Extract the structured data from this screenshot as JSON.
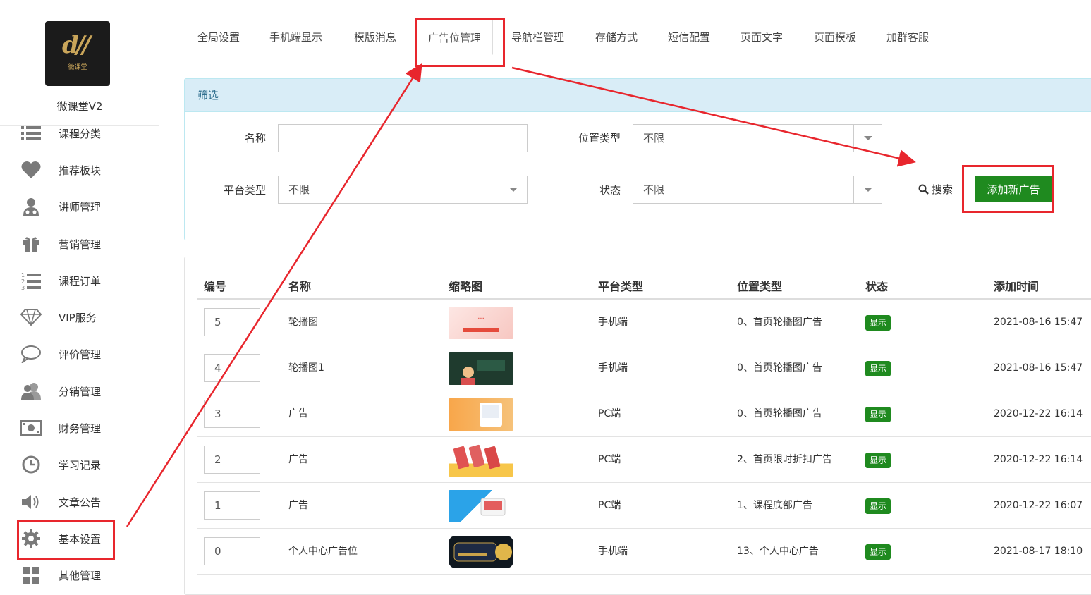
{
  "app": {
    "name": "微课堂V2",
    "logo_text": "微课堂"
  },
  "sidebar": {
    "items": [
      {
        "label": "课程分类",
        "icon": "list-icon"
      },
      {
        "label": "推荐板块",
        "icon": "heart-icon"
      },
      {
        "label": "讲师管理",
        "icon": "teacher-icon"
      },
      {
        "label": "营销管理",
        "icon": "gift-icon"
      },
      {
        "label": "课程订单",
        "icon": "ordered-list-icon"
      },
      {
        "label": "VIP服务",
        "icon": "diamond-icon"
      },
      {
        "label": "评价管理",
        "icon": "comment-icon"
      },
      {
        "label": "分销管理",
        "icon": "users-icon"
      },
      {
        "label": "财务管理",
        "icon": "money-icon"
      },
      {
        "label": "学习记录",
        "icon": "clock-icon"
      },
      {
        "label": "文章公告",
        "icon": "speaker-icon"
      },
      {
        "label": "基本设置",
        "icon": "gear-icon"
      },
      {
        "label": "其他管理",
        "icon": "grid-icon"
      }
    ]
  },
  "tabs": [
    {
      "label": "全局设置"
    },
    {
      "label": "手机端显示"
    },
    {
      "label": "模版消息"
    },
    {
      "label": "广告位管理"
    },
    {
      "label": "导航栏管理"
    },
    {
      "label": "存储方式"
    },
    {
      "label": "短信配置"
    },
    {
      "label": "页面文字"
    },
    {
      "label": "页面模板"
    },
    {
      "label": "加群客服"
    }
  ],
  "filter": {
    "title": "筛选",
    "name_label": "名称",
    "name_value": "",
    "position_label": "位置类型",
    "position_value": "不限",
    "platform_label": "平台类型",
    "platform_value": "不限",
    "status_label": "状态",
    "status_value": "不限",
    "search_label": "搜索",
    "add_label": "添加新广告"
  },
  "table": {
    "headers": [
      "编号",
      "名称",
      "缩略图",
      "平台类型",
      "位置类型",
      "状态",
      "添加时间"
    ],
    "rows": [
      {
        "num": "5",
        "name": "轮播图",
        "platform": "手机端",
        "position": "0、首页轮播图广告",
        "status": "显示",
        "time": "2021-08-16 15:47"
      },
      {
        "num": "4",
        "name": "轮播图1",
        "platform": "手机端",
        "position": "0、首页轮播图广告",
        "status": "显示",
        "time": "2021-08-16 15:47"
      },
      {
        "num": "3",
        "name": "广告",
        "platform": "PC端",
        "position": "0、首页轮播图广告",
        "status": "显示",
        "time": "2020-12-22 16:14"
      },
      {
        "num": "2",
        "name": "广告",
        "platform": "PC端",
        "position": "2、首页限时折扣广告",
        "status": "显示",
        "time": "2020-12-22 16:14"
      },
      {
        "num": "1",
        "name": "广告",
        "platform": "PC端",
        "position": "1、课程底部广告",
        "status": "显示",
        "time": "2020-12-22 16:07"
      },
      {
        "num": "0",
        "name": "个人中心广告位",
        "platform": "手机端",
        "position": "13、个人中心广告",
        "status": "显示",
        "time": "2021-08-17 18:10"
      }
    ]
  },
  "colors": {
    "highlight": "#e8262d",
    "primary_green": "#1f8a1f",
    "filter_head_bg": "#d9edf7",
    "filter_head_text": "#31708f"
  }
}
